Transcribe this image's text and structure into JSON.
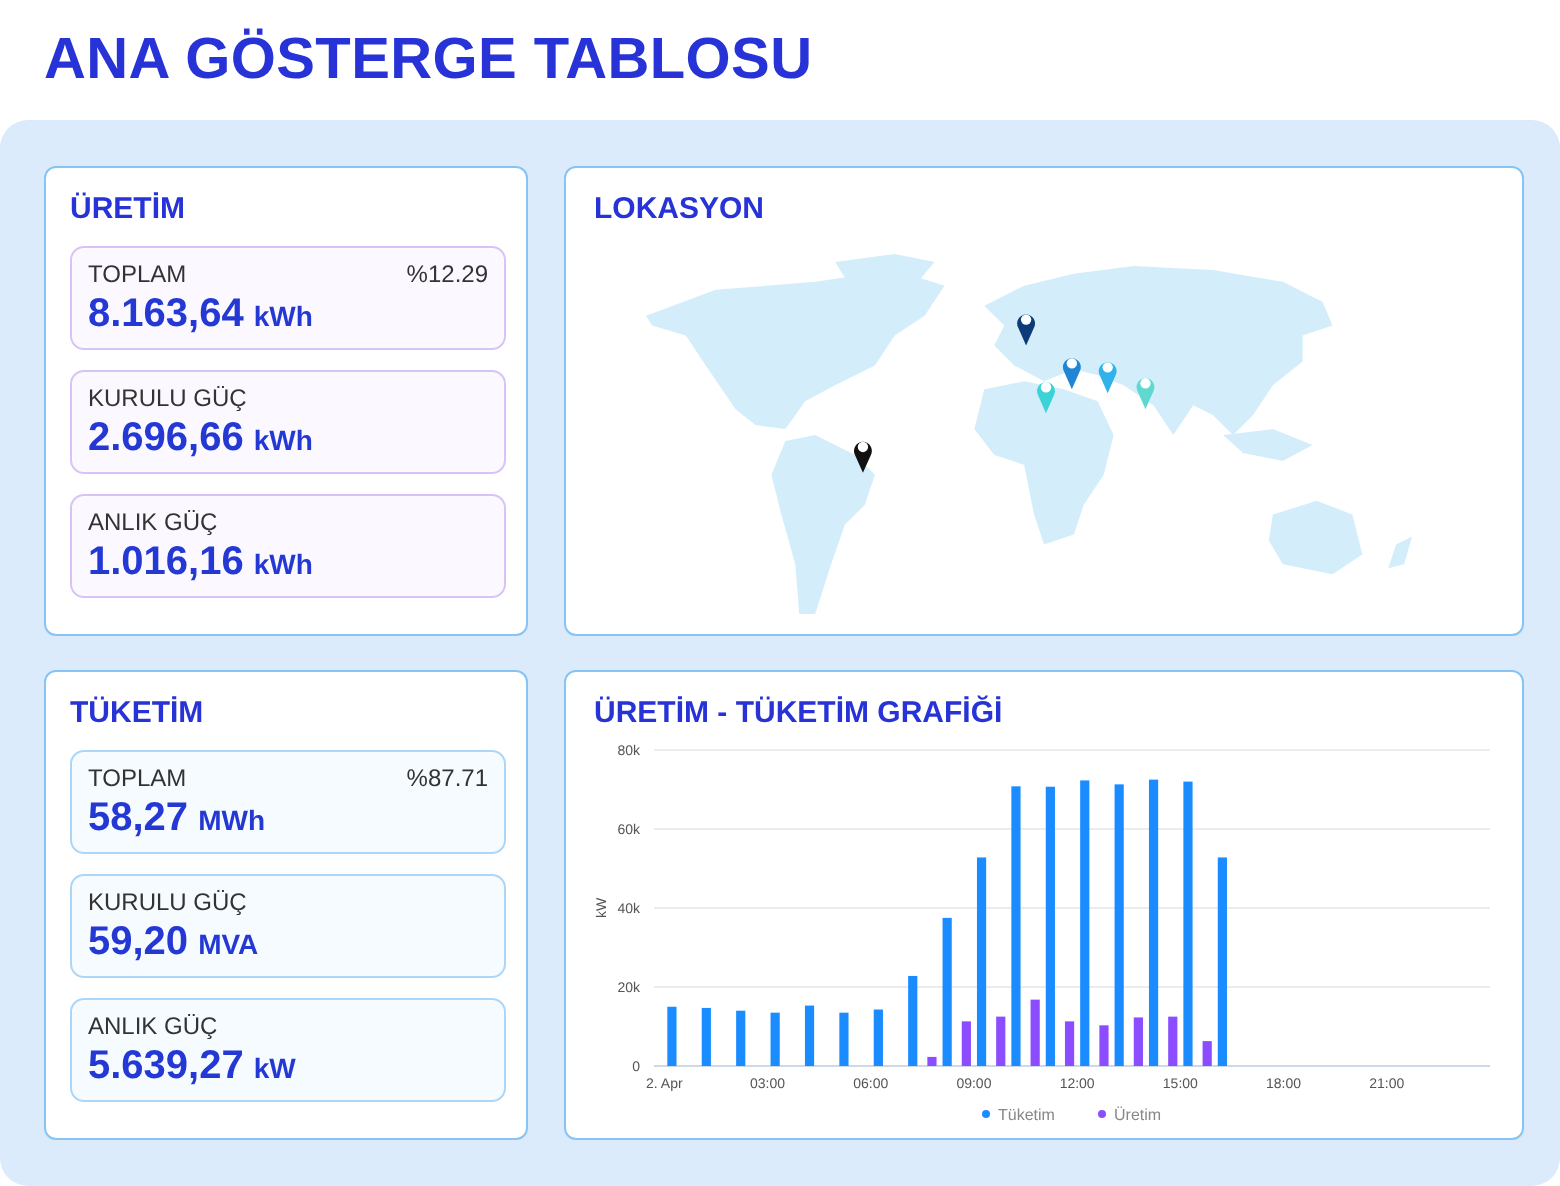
{
  "title": "ANA GÖSTERGE TABLOSU",
  "stat_panels": [
    {
      "title": "ÜRETİM",
      "kind": "production",
      "items": [
        {
          "label": "TOPLAM",
          "badge": "%12.29",
          "value": "8.163,64",
          "unit": "kWh"
        },
        {
          "label": "KURULU GÜÇ",
          "value": "2.696,66",
          "unit": "kWh"
        },
        {
          "label": "ANLIK GÜÇ",
          "value": "1.016,16",
          "unit": "kWh"
        }
      ]
    },
    {
      "title": "TÜKETİM",
      "kind": "consumption",
      "items": [
        {
          "label": "TOPLAM",
          "badge": "%87.71",
          "value": "58,27",
          "unit": "MWh"
        },
        {
          "label": "KURULU GÜÇ",
          "value": "59,20",
          "unit": "MVA"
        },
        {
          "label": "ANLIK GÜÇ",
          "value": "5.639,27",
          "unit": "kW"
        }
      ]
    }
  ],
  "map_panel": {
    "title": "LOKASYON",
    "pins": [
      {
        "color": "#0d3b7a"
      },
      {
        "color": "#1f86d6"
      },
      {
        "color": "#2fb3ea"
      },
      {
        "color": "#3cd3d6"
      },
      {
        "color": "#5fd9cf"
      },
      {
        "color": "#111111"
      }
    ]
  },
  "chart_panel": {
    "title": "ÜRETİM - TÜKETİM GRAFİĞİ",
    "chart_data": {
      "type": "bar",
      "ylabel": "kW",
      "x": [
        0,
        1,
        2,
        3,
        4,
        5,
        6,
        7,
        8,
        9,
        10,
        11,
        12,
        13,
        14,
        15,
        16
      ],
      "series": [
        {
          "name": "Tüketim",
          "color": "#1a8cff",
          "values": [
            15000,
            14700,
            14000,
            13500,
            15300,
            13500,
            14300,
            22800,
            37500,
            52800,
            70800,
            70700,
            72300,
            71300,
            72500,
            72000,
            52800
          ]
        },
        {
          "name": "Üretim",
          "color": "#8b4dff",
          "values": [
            null,
            null,
            null,
            null,
            null,
            null,
            null,
            null,
            2300,
            11300,
            12500,
            16800,
            11300,
            10300,
            12300,
            12500,
            6300
          ]
        }
      ],
      "grid": true,
      "legend": true,
      "xlim": [
        -0.3,
        24
      ],
      "ylim": [
        0,
        80000
      ],
      "xticks": [
        {
          "value": 0,
          "label": "2. Apr"
        },
        {
          "value": 3,
          "label": "03:00"
        },
        {
          "value": 6,
          "label": "06:00"
        },
        {
          "value": 9,
          "label": "09:00"
        },
        {
          "value": 12,
          "label": "12:00"
        },
        {
          "value": 15,
          "label": "15:00"
        },
        {
          "value": 18,
          "label": "18:00"
        },
        {
          "value": 21,
          "label": "21:00"
        }
      ],
      "yticks": [
        {
          "value": 0,
          "label": "0"
        },
        {
          "value": 20000,
          "label": "20k"
        },
        {
          "value": 40000,
          "label": "40k"
        },
        {
          "value": 60000,
          "label": "60k"
        },
        {
          "value": 80000,
          "label": "80k"
        }
      ]
    }
  }
}
